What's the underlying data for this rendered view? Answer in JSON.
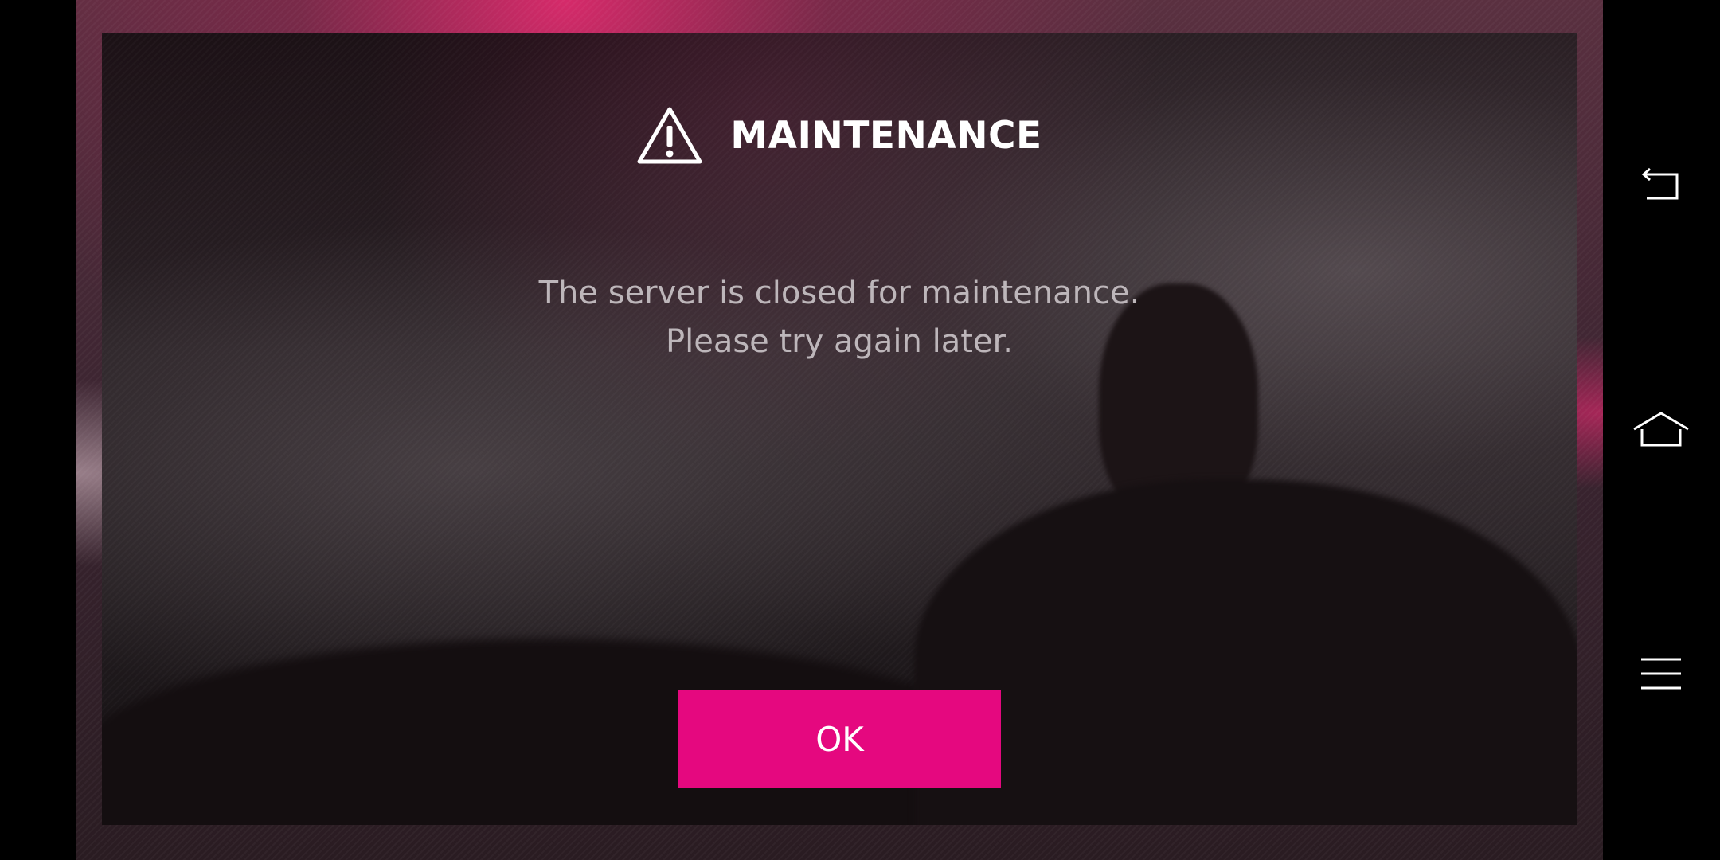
{
  "dialog": {
    "title": "MAINTENANCE",
    "title_icon": "warning-triangle-icon",
    "message_line1": "The server is closed for maintenance.",
    "message_line2": "Please try again later.",
    "ok_label": "OK"
  },
  "nav_bar": {
    "items": [
      {
        "name": "back",
        "icon": "back-icon"
      },
      {
        "name": "home",
        "icon": "home-icon"
      },
      {
        "name": "menu",
        "icon": "menu-icon"
      }
    ]
  },
  "colors": {
    "accent": "#e5087f",
    "title": "#ffffff",
    "message": "#bdb6ba",
    "panel": "#231d20"
  }
}
